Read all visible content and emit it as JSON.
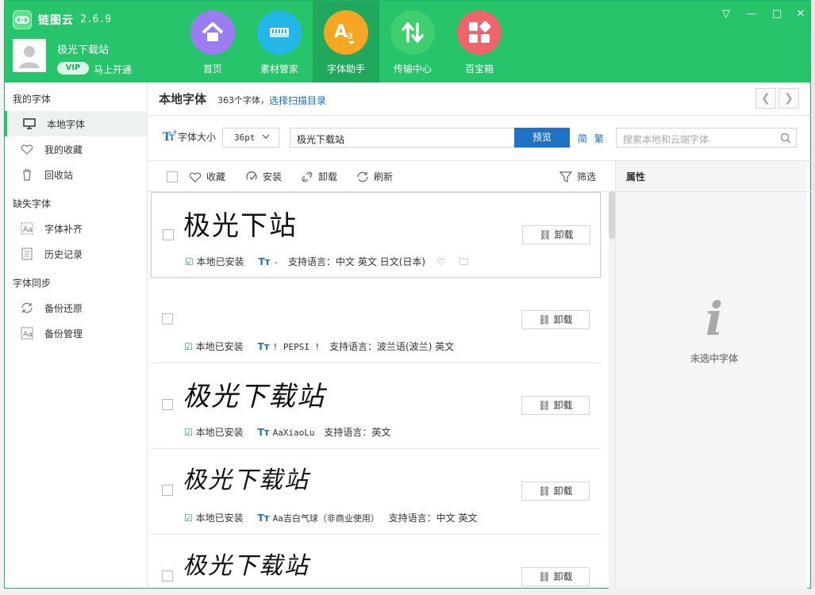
{
  "app": {
    "name": "链图云",
    "version": "2.6.9"
  },
  "user": {
    "name": "极光下载站",
    "vip_badge": "VIP",
    "vip_cta": "马上开通"
  },
  "nav": [
    {
      "label": "首页",
      "icon": "home-icon",
      "color": "#9c7cf3"
    },
    {
      "label": "素材管家",
      "icon": "material-icon",
      "color": "#25b6e8"
    },
    {
      "label": "字体助手",
      "icon": "font-icon",
      "color": "#f6a623"
    },
    {
      "label": "传输中心",
      "icon": "transfer-icon",
      "color": "#3fcf6e"
    },
    {
      "label": "百宝箱",
      "icon": "toolbox-icon",
      "color": "#f0646c"
    }
  ],
  "window_controls": [
    "▽",
    "—",
    "□",
    "✕"
  ],
  "sidebar": {
    "sections": [
      {
        "title": "我的字体",
        "items": [
          {
            "label": "本地字体",
            "icon": "monitor-icon"
          },
          {
            "label": "我的收藏",
            "icon": "heart-icon"
          },
          {
            "label": "回收站",
            "icon": "trash-icon"
          }
        ]
      },
      {
        "title": "缺失字体",
        "items": [
          {
            "label": "字体补齐",
            "icon": "font-fill-icon"
          },
          {
            "label": "历史记录",
            "icon": "history-icon"
          }
        ]
      },
      {
        "title": "字体同步",
        "items": [
          {
            "label": "备份还原",
            "icon": "sync-icon"
          },
          {
            "label": "备份管理",
            "icon": "backup-manage-icon"
          }
        ]
      }
    ]
  },
  "main": {
    "title": "本地字体",
    "count_text": "363个字体，",
    "scan_link": "选择扫描目录",
    "font_size_label": "字体大小",
    "font_size_value": "36pt",
    "preview_text": "极光下载站",
    "preview_button": "预览",
    "lang_simple": "简",
    "lang_traditional": "繁",
    "search_placeholder": "搜索本地和云端字体",
    "toolbar": {
      "favorite": "收藏",
      "install": "安装",
      "uninstall": "卸载",
      "refresh": "刷新",
      "filter": "筛选"
    }
  },
  "fonts": [
    {
      "sample": "极光下站",
      "status": "本地已安装",
      "font_name": "-",
      "languages": "支持语言：中文 英文 日文(日本)",
      "action": "卸载"
    },
    {
      "sample": "",
      "status": "本地已安装",
      "font_name": "! PEPSI !",
      "languages": "支持语言：波兰语(波兰) 英文",
      "action": "卸载"
    },
    {
      "sample": "极光下载站",
      "status": "本地已安装",
      "font_name": "AaXiaoLu",
      "languages": "支持语言：英文",
      "action": "卸载"
    },
    {
      "sample": "极光下载站",
      "status": "本地已安装",
      "font_name": "Aa吉白气球（非商业使用）",
      "languages": "支持语言：中文 英文",
      "action": "卸载"
    },
    {
      "sample": "极光下载站",
      "status": "",
      "font_name": "",
      "languages": "",
      "action": "卸载"
    }
  ],
  "properties": {
    "title": "属性",
    "empty_text": "未选中字体"
  }
}
